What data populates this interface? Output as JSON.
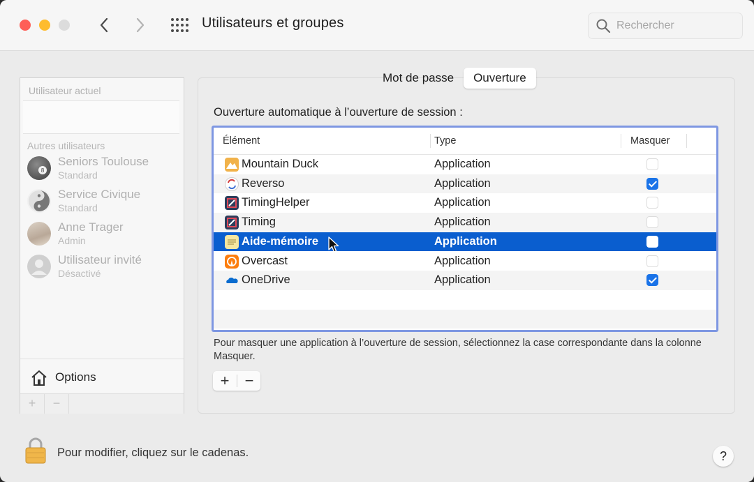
{
  "window": {
    "title": "Utilisateurs et groupes",
    "search_placeholder": "Rechercher"
  },
  "sidebar": {
    "current_user_header": "Utilisateur actuel",
    "other_users_header": "Autres utilisateurs",
    "users": [
      {
        "name": "Seniors Toulouse",
        "role": "Standard",
        "avatar": "billiard-ball-avatar"
      },
      {
        "name": "Service Civique",
        "role": "Standard",
        "avatar": "yin-yang-avatar"
      },
      {
        "name": "Anne Trager",
        "role": "Admin",
        "avatar": "photo-avatar"
      },
      {
        "name": "Utilisateur invité",
        "role": "Désactivé",
        "avatar": "generic-user-avatar"
      }
    ],
    "options_label": "Options",
    "add_symbol": "+",
    "remove_symbol": "−"
  },
  "tabs": [
    {
      "label": "Mot de passe",
      "active": false
    },
    {
      "label": "Ouverture",
      "active": true
    }
  ],
  "login_items": {
    "section_title": "Ouverture automatique à l’ouverture de session :",
    "columns": {
      "element": "Élément",
      "type": "Type",
      "hide": "Masquer"
    },
    "rows": [
      {
        "name": "Mountain Duck",
        "type": "Application",
        "hide": false,
        "icon": "mountain-duck-icon",
        "color": "#e8a33c"
      },
      {
        "name": "Reverso",
        "type": "Application",
        "hide": true,
        "icon": "reverso-icon",
        "color": "#4a7fd6"
      },
      {
        "name": "TimingHelper",
        "type": "Application",
        "hide": false,
        "icon": "timing-helper-icon",
        "color": "#2c3e5c"
      },
      {
        "name": "Timing",
        "type": "Application",
        "hide": false,
        "icon": "timing-icon",
        "color": "#2c3e5c"
      },
      {
        "name": "Aide-mémoire",
        "type": "Application",
        "hide": false,
        "selected": true,
        "icon": "stickies-icon",
        "color": "#f3df7a"
      },
      {
        "name": "Overcast",
        "type": "Application",
        "hide": false,
        "icon": "overcast-icon",
        "color": "#fc7e0f"
      },
      {
        "name": "OneDrive",
        "type": "Application",
        "hide": true,
        "icon": "onedrive-icon",
        "color": "#0a6ccf"
      }
    ],
    "hint": "Pour masquer une application à l’ouverture de session, sélectionnez la case correspondante dans la colonne Masquer.",
    "add_symbol": "+",
    "remove_symbol": "−"
  },
  "footer": {
    "lock_text": "Pour modifier, cliquez sur le cadenas.",
    "help_symbol": "?"
  },
  "colors": {
    "selection": "#0a5ecf",
    "checkbox_on": "#1a73e8",
    "table_focus_ring": "#7e97e2"
  }
}
